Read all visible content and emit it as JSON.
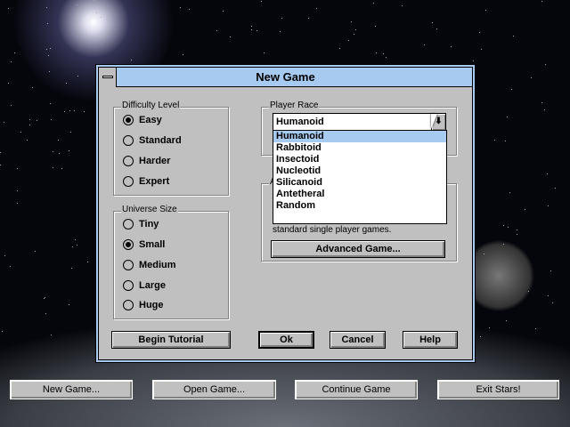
{
  "dialog": {
    "title": "New Game",
    "difficulty": {
      "label": "Difficulty Level",
      "options": [
        "Easy",
        "Standard",
        "Harder",
        "Expert"
      ],
      "selected": "Easy"
    },
    "universe": {
      "label": "Universe Size",
      "options": [
        "Tiny",
        "Small",
        "Medium",
        "Large",
        "Huge"
      ],
      "selected": "Small"
    },
    "race": {
      "label": "Player Race",
      "value": "Humanoid",
      "options": [
        "Humanoid",
        "Rabbitoid",
        "Insectoid",
        "Nucleotid",
        "Silicanoid",
        "Antetheral",
        "Random"
      ],
      "highlighted": "Humanoid"
    },
    "advanced_group": {
      "label_fragment": "A",
      "description": "standard single player games.",
      "button_label": "Advanced Game..."
    },
    "buttons": {
      "tutorial": "Begin Tutorial",
      "ok": "Ok",
      "cancel": "Cancel",
      "help": "Help"
    }
  },
  "main_buttons": [
    "New Game...",
    "Open Game...",
    "Continue Game",
    "Exit Stars!"
  ]
}
